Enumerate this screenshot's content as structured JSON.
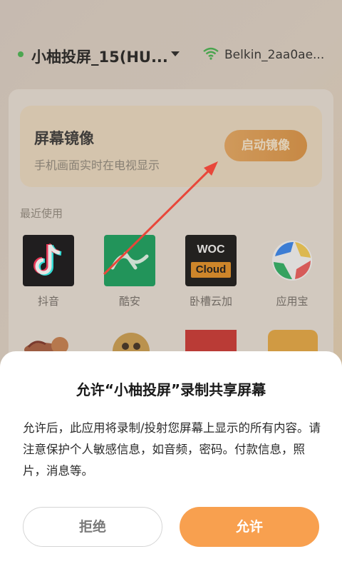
{
  "header": {
    "device_name": "小柚投屏_15(HU...",
    "wifi_name": "Belkin_2aa0ae..."
  },
  "mirror": {
    "title": "屏幕镜像",
    "subtitle": "手机画面实时在电视显示",
    "button": "启动镜像"
  },
  "recent": {
    "label": "最近使用",
    "apps": [
      {
        "label": "抖音",
        "icon": "douyin-icon"
      },
      {
        "label": "酷安",
        "icon": "coolapk-icon"
      },
      {
        "label": "卧槽云加",
        "icon": "woc-cloud-icon",
        "icon_text_top": "WOC",
        "icon_text_bottom": "Cloud"
      },
      {
        "label": "应用宝",
        "icon": "yingyongbao-icon"
      }
    ]
  },
  "dialog": {
    "title": "允许“小柚投屏”录制共享屏幕",
    "body": "允许后，此应用将录制/投射您屏幕上显示的所有内容。请注意保护个人敏感信息，如音频，密码。付款信息，照片，消息等。",
    "deny_label": "拒绝",
    "allow_label": "允许"
  },
  "colors": {
    "accent": "#f8a04f",
    "status_green": "#42b34c"
  }
}
